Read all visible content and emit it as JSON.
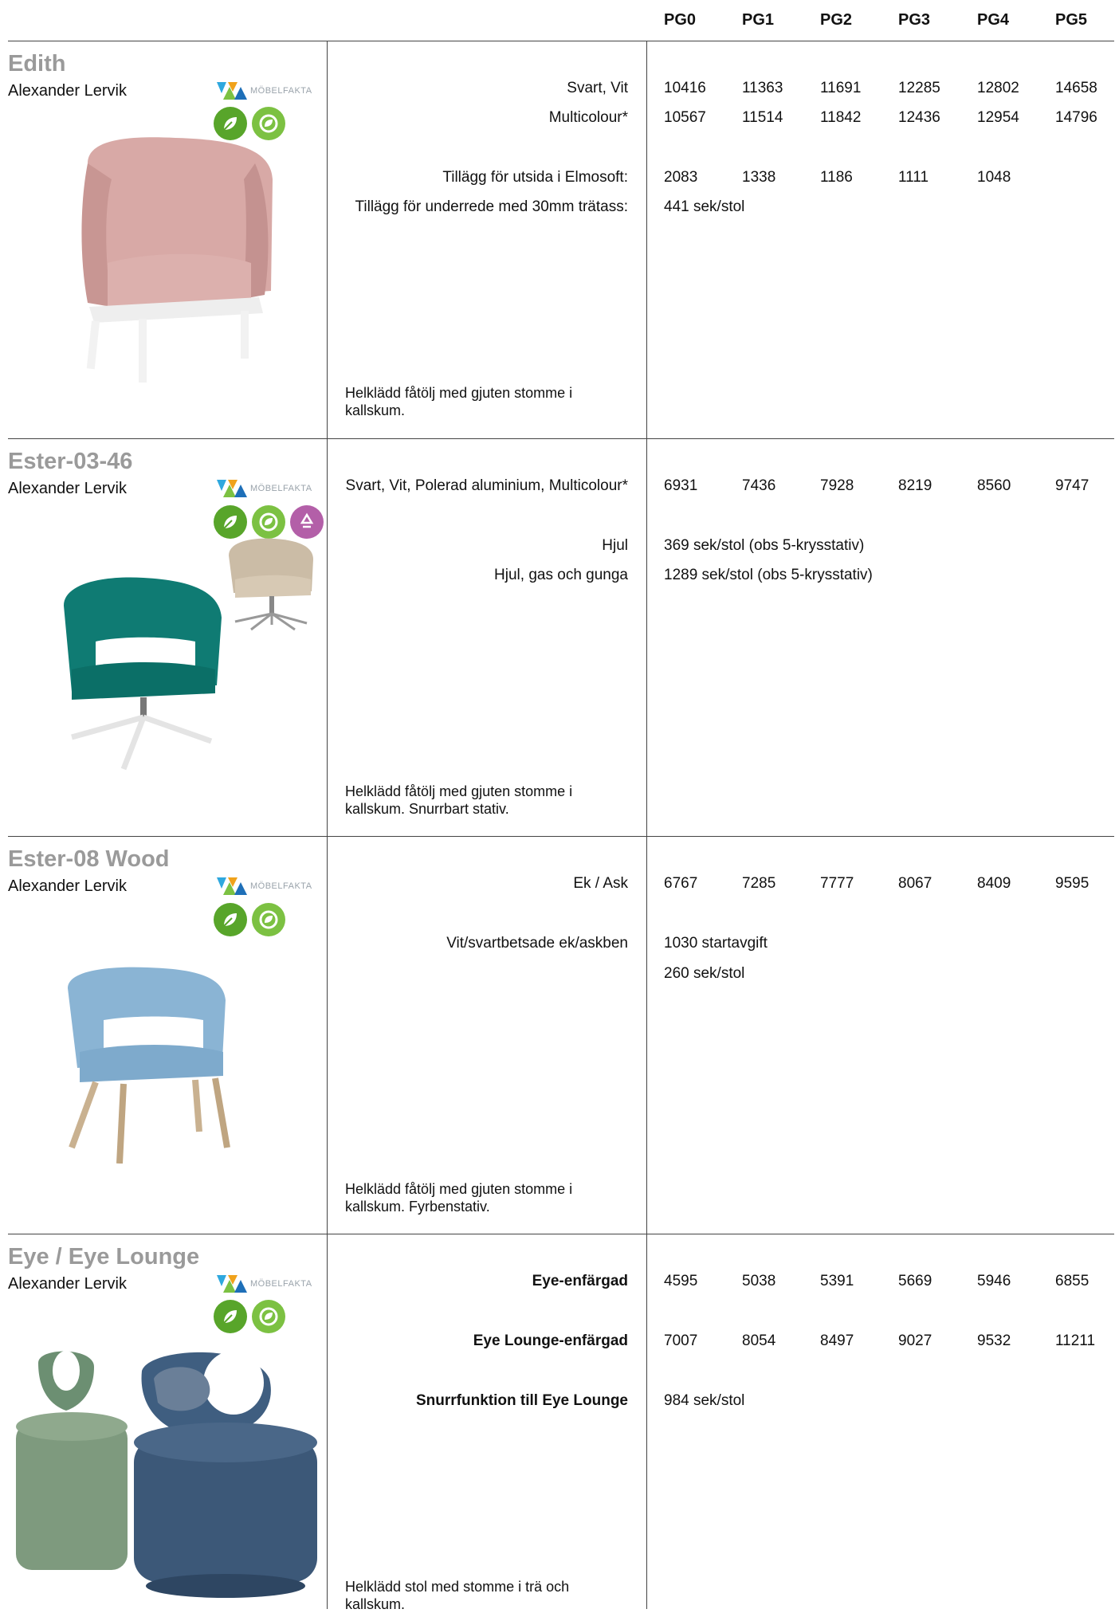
{
  "header": {
    "price_groups": [
      "PG0",
      "PG1",
      "PG2",
      "PG3",
      "PG4",
      "PG5"
    ]
  },
  "brand": {
    "mobelfakta": "MÖBELFAKTA"
  },
  "products": [
    {
      "name": "Edith",
      "designer": "Alexander Lervik",
      "description": "Helklädd fåtölj med gjuten stomme i kallskum.",
      "rows": [
        {
          "label": "Svart, Vit",
          "prices": [
            "10416",
            "11363",
            "11691",
            "12285",
            "12802",
            "14658"
          ]
        },
        {
          "label": "Multicolour*",
          "prices": [
            "10567",
            "11514",
            "11842",
            "12436",
            "12954",
            "14796"
          ]
        },
        {
          "label": "Tillägg för utsida i Elmosoft:",
          "prices": [
            "2083",
            "1338",
            "1186",
            "1111",
            "1048"
          ]
        },
        {
          "label": "Tillägg för underrede med 30mm trätass:",
          "note": "441 sek/stol"
        }
      ]
    },
    {
      "name": "Ester-03-46",
      "designer": "Alexander Lervik",
      "description": "Helklädd fåtölj med gjuten stomme i kallskum. Snurrbart stativ.",
      "rows": [
        {
          "label": "Svart, Vit, Polerad aluminium, Multicolour*",
          "prices": [
            "6931",
            "7436",
            "7928",
            "8219",
            "8560",
            "9747"
          ]
        },
        {
          "label": "Hjul",
          "note": "369 sek/stol (obs 5-krysstativ)"
        },
        {
          "label": "Hjul, gas och gunga",
          "note": "1289 sek/stol (obs 5-krysstativ)"
        }
      ]
    },
    {
      "name": "Ester-08 Wood",
      "designer": "Alexander Lervik",
      "description": "Helklädd fåtölj med gjuten stomme i kallskum. Fyrbenstativ.",
      "rows": [
        {
          "label": "Ek / Ask",
          "prices": [
            "6767",
            "7285",
            "7777",
            "8067",
            "8409",
            "9595"
          ]
        },
        {
          "label": "Vit/svartbetsade ek/askben",
          "note": "1030 startavgift"
        },
        {
          "label": "",
          "note": "260 sek/stol"
        }
      ]
    },
    {
      "name": "Eye / Eye Lounge",
      "designer": "Alexander Lervik",
      "description": "Helklädd stol med stomme i trä och kallskum.",
      "rows": [
        {
          "label": "Eye-enfärgad",
          "prices": [
            "4595",
            "5038",
            "5391",
            "5669",
            "5946",
            "6855"
          ]
        },
        {
          "label": "Eye Lounge-enfärgad",
          "prices": [
            "7007",
            "8054",
            "8497",
            "9027",
            "9532",
            "11211"
          ]
        },
        {
          "label": "Snurrfunktion till Eye Lounge",
          "note": "984 sek/stol"
        }
      ]
    }
  ],
  "colors": {
    "name_gray": "#9a9a9a",
    "rule": "#444444",
    "eco_green": "#58a52a",
    "eco_light": "#7cc142",
    "recycle_pink": "#b35fa8"
  },
  "icons": [
    "mobelfakta-logo-icon",
    "leaf-icon",
    "recycle-leaf-icon",
    "recycle-icon"
  ]
}
